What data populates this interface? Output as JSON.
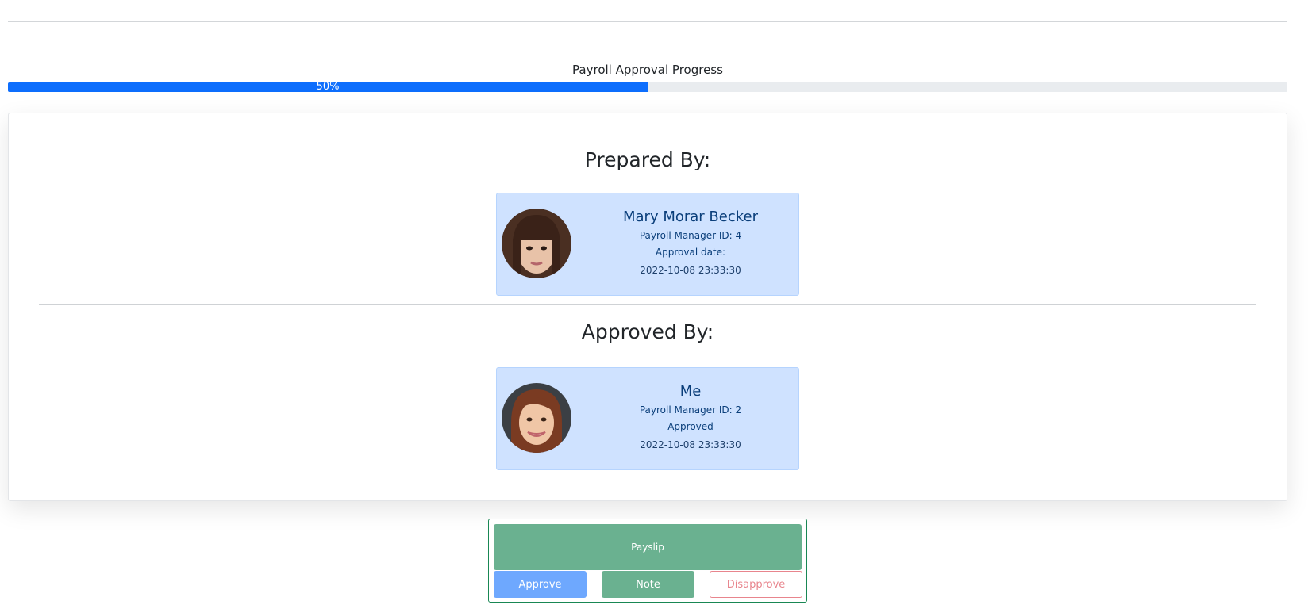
{
  "progress": {
    "title": "Payroll Approval Progress",
    "percent_label": "50%",
    "value": 0.5,
    "color": "#0d6efd"
  },
  "prepared": {
    "heading": "Prepared By:",
    "name": "Mary Morar Becker",
    "manager_id": "Payroll Manager ID: 4",
    "status": "Approval date:",
    "date": "2022-10-08 23:33:30"
  },
  "approved": {
    "heading": "Approved By:",
    "name": "Me",
    "manager_id": "Payroll Manager ID: 2",
    "status": "Approved",
    "date": "2022-10-08 23:33:30"
  },
  "actions": {
    "payslip_label": "Payslip",
    "approve_label": "Approve",
    "note_label": "Note",
    "disapprove_label": "Disapprove"
  },
  "colors": {
    "card_bg": "#cfe2ff",
    "success": "#198754",
    "danger": "#e8858d"
  }
}
